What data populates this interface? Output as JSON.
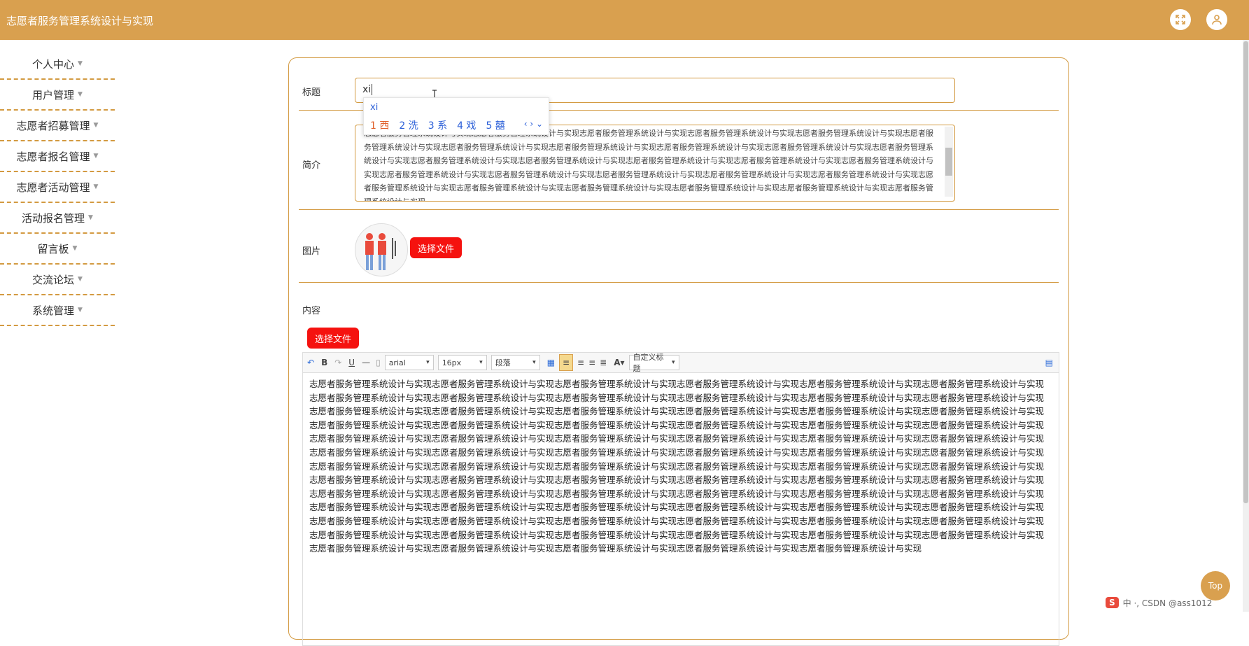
{
  "app": {
    "title": "志愿者服务管理系统设计与实现"
  },
  "sidebar": {
    "items": [
      {
        "label": "个人中心"
      },
      {
        "label": "用户管理"
      },
      {
        "label": "志愿者招募管理"
      },
      {
        "label": "志愿者报名管理"
      },
      {
        "label": "志愿者活动管理"
      },
      {
        "label": "活动报名管理"
      },
      {
        "label": "留言板"
      },
      {
        "label": "交流论坛"
      },
      {
        "label": "系统管理"
      }
    ]
  },
  "form": {
    "title_label": "标题",
    "title_value": "xi",
    "intro_label": "简介",
    "intro_text": "志愿者服务管理系统设计与实现志愿者服务管理系统设计与实现志愿者服务管理系统设计与实现志愿者服务管理系统设计与实现志愿者服务管理系统设计与实现志愿者服务管理系统设计与实现志愿者服务管理系统设计与实现志愿者服务管理系统设计与实现志愿者服务管理系统设计与实现志愿者服务管理系统设计与实现志愿者服务管理系统设计与实现志愿者服务管理系统设计与实现志愿者服务管理系统设计与实现志愿者服务管理系统设计与实现志愿者服务管理系统设计与实现志愿者服务管理系统设计与实现志愿者服务管理系统设计与实现志愿者服务管理系统设计与实现志愿者服务管理系统设计与实现志愿者服务管理系统设计与实现志愿者服务管理系统设计与实现志愿者服务管理系统设计与实现志愿者服务管理系统设计与实现志愿者服务管理系统设计与实现志愿者服务管理系统设计与实现志愿者服务管理系统设计与实现志愿者服务管理系统设计与实现",
    "image_label": "图片",
    "choose_file_label": "选择文件",
    "content_label": "内容",
    "content_choose_file_label": "选择文件",
    "content_text": "志愿者服务管理系统设计与实现志愿者服务管理系统设计与实现志愿者服务管理系统设计与实现志愿者服务管理系统设计与实现志愿者服务管理系统设计与实现志愿者服务管理系统设计与实现志愿者服务管理系统设计与实现志愿者服务管理系统设计与实现志愿者服务管理系统设计与实现志愿者服务管理系统设计与实现志愿者服务管理系统设计与实现志愿者服务管理系统设计与实现志愿者服务管理系统设计与实现志愿者服务管理系统设计与实现志愿者服务管理系统设计与实现志愿者服务管理系统设计与实现志愿者服务管理系统设计与实现志愿者服务管理系统设计与实现志愿者服务管理系统设计与实现志愿者服务管理系统设计与实现志愿者服务管理系统设计与实现志愿者服务管理系统设计与实现志愿者服务管理系统设计与实现志愿者服务管理系统设计与实现志愿者服务管理系统设计与实现志愿者服务管理系统设计与实现志愿者服务管理系统设计与实现志愿者服务管理系统设计与实现志愿者服务管理系统设计与实现志愿者服务管理系统设计与实现志愿者服务管理系统设计与实现志愿者服务管理系统设计与实现志愿者服务管理系统设计与实现志愿者服务管理系统设计与实现志愿者服务管理系统设计与实现志愿者服务管理系统设计与实现志愿者服务管理系统设计与实现志愿者服务管理系统设计与实现志愿者服务管理系统设计与实现志愿者服务管理系统设计与实现志愿者服务管理系统设计与实现志愿者服务管理系统设计与实现志愿者服务管理系统设计与实现志愿者服务管理系统设计与实现志愿者服务管理系统设计与实现志愿者服务管理系统设计与实现志愿者服务管理系统设计与实现志愿者服务管理系统设计与实现志愿者服务管理系统设计与实现志愿者服务管理系统设计与实现志愿者服务管理系统设计与实现志愿者服务管理系统设计与实现志愿者服务管理系统设计与实现志愿者服务管理系统设计与实现志愿者服务管理系统设计与实现志愿者服务管理系统设计与实现志愿者服务管理系统设计与实现志愿者服务管理系统设计与实现志愿者服务管理系统设计与实现志愿者服务管理系统设计与实现志愿者服务管理系统设计与实现志愿者服务管理系统设计与实现志愿者服务管理系统设计与实现志愿者服务管理系统设计与实现志愿者服务管理系统设计与实现志愿者服务管理系统设计与实现志愿者服务管理系统设计与实现志愿者服务管理系统设计与实现志愿者服务管理系统设计与实现志愿者服务管理系统设计与实现志愿者服务管理系统设计与实现志愿者服务管理系统设计与实现志愿者服务管理系统设计与实现志愿者服务管理系统设计与实现志愿者服务管理系统设计与实现志愿者服务管理系统设计与实现志愿者服务管理系统设计与实现"
  },
  "ime": {
    "pinyin": "xi",
    "candidates": [
      "1 西",
      "2 洗",
      "3 系",
      "4 戏",
      "5 囍"
    ]
  },
  "editor_toolbar": {
    "font_family": "arial",
    "font_size": "16px",
    "paragraph": "段落",
    "custom_title": "自定义标题"
  },
  "misc": {
    "top_button": "Top",
    "tray_text": "中 ·, CSDN @ass1012"
  },
  "colors": {
    "brand": "#d9a04f",
    "border": "#d39a41",
    "button_red": "#f5120f"
  }
}
